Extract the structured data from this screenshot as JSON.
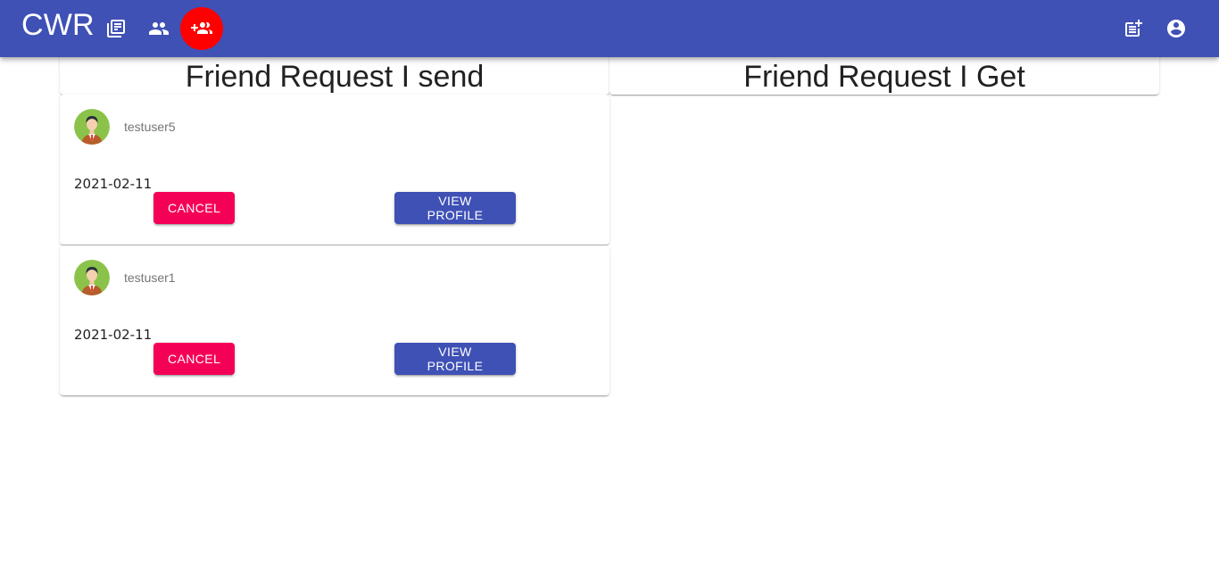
{
  "app": {
    "brand": "CWR"
  },
  "nav": {
    "icons": [
      "library-icon",
      "people-icon",
      "group-add-icon",
      "post-add-icon",
      "account-circle-icon"
    ]
  },
  "colors": {
    "appbar": "#3f51b5",
    "active_nav": "#ff0000",
    "cancel": "#f50057",
    "primary": "#3f51b5"
  },
  "sections": {
    "sent_title": "Friend Request I send",
    "received_title": "Friend Request I Get"
  },
  "requests": [
    {
      "username": "testuser5",
      "date": "2021-02-11",
      "cancel_label": "CANCEL",
      "view_label": "VIEW PROFILE"
    },
    {
      "username": "testuser1",
      "date": "2021-02-11",
      "cancel_label": "CANCEL",
      "view_label": "VIEW PROFILE"
    }
  ]
}
